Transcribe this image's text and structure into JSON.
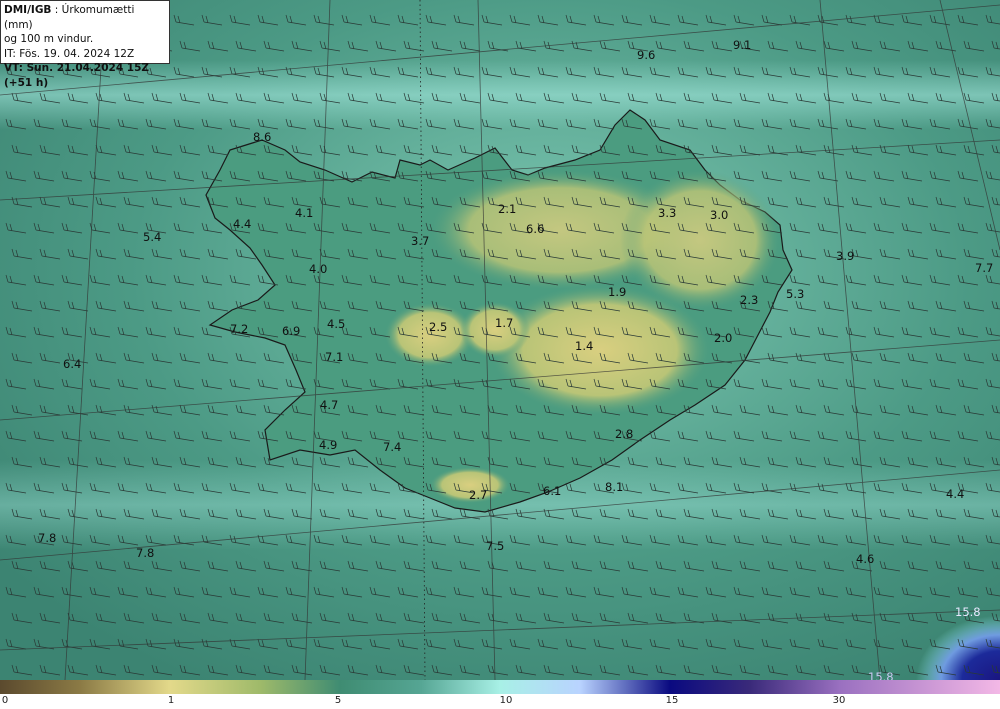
{
  "header": {
    "source": "DMI/IGB",
    "parameter": "Úrkomumætti (mm)",
    "parameter2": "og 100 m vindur.",
    "initial_time": "IT: Fös. 19. 04. 2024 12Z",
    "valid_time": "VT: Sun. 21.04.2024 15Z (+51 h)"
  },
  "colorbar": {
    "ticks": [
      "0",
      "1",
      "5",
      "10",
      "15",
      "30"
    ],
    "colors": [
      "#5b4a2e",
      "#8b7a45",
      "#e3d98a",
      "#9fba6a",
      "#3f8c72",
      "#55a593",
      "#a8f0e6",
      "#b9d3ff",
      "#0a0a80",
      "#3a2a7a",
      "#9a70c0",
      "#f3b8e6"
    ]
  },
  "values": [
    {
      "text": "9.6"
    },
    {
      "text": "9.1"
    },
    {
      "text": "8.6"
    },
    {
      "text": "4.1"
    },
    {
      "text": "4.4"
    },
    {
      "text": "5.4"
    },
    {
      "text": "2.1"
    },
    {
      "text": "6.6"
    },
    {
      "text": "3.3"
    },
    {
      "text": "3.0"
    },
    {
      "text": "3.7"
    },
    {
      "text": "4.0"
    },
    {
      "text": "3.9"
    },
    {
      "text": "7.7"
    },
    {
      "text": "1.9"
    },
    {
      "text": "2.3"
    },
    {
      "text": "5.3"
    },
    {
      "text": "7.2"
    },
    {
      "text": "6.9"
    },
    {
      "text": "4.5"
    },
    {
      "text": "2.5"
    },
    {
      "text": "1.7"
    },
    {
      "text": "1.4"
    },
    {
      "text": "2.0"
    },
    {
      "text": "7.1"
    },
    {
      "text": "6.4"
    },
    {
      "text": "4.7"
    },
    {
      "text": "4.9"
    },
    {
      "text": "7.4"
    },
    {
      "text": "2.8"
    },
    {
      "text": "2.7"
    },
    {
      "text": "6.1"
    },
    {
      "text": "8.1"
    },
    {
      "text": "4.4"
    },
    {
      "text": "7.8"
    },
    {
      "text": "7.8"
    },
    {
      "text": "7.5"
    },
    {
      "text": "4.6"
    },
    {
      "text": "15.8"
    },
    {
      "text": "15.8"
    }
  ]
}
